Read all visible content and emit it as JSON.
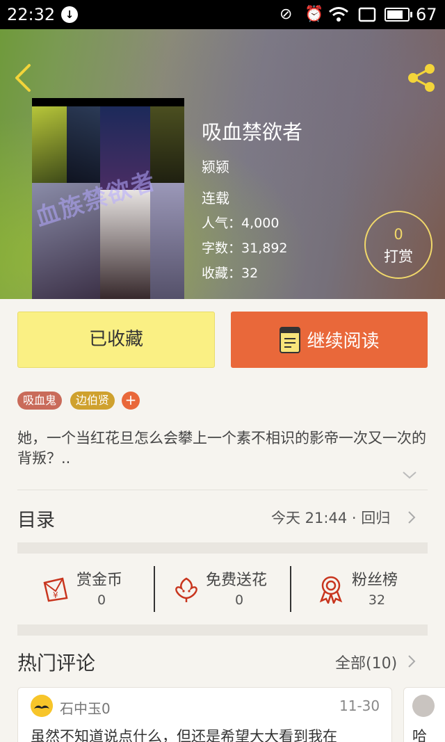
{
  "status_bar": {
    "time": "22:32",
    "battery": "67"
  },
  "book": {
    "title": "吸血禁欲者",
    "author": "颍颍",
    "status": "连载",
    "popularity_label": "人气：",
    "popularity": "4,000",
    "words_label": "字数：",
    "words": "31,892",
    "favorites_label": "收藏：",
    "favorites": "32",
    "cover_watermark": "血族禁欲者"
  },
  "tip": {
    "count": "0",
    "label": "打赏"
  },
  "buttons": {
    "favorite": "已收藏",
    "continue_reading": "继续阅读"
  },
  "tags": [
    "吸血鬼",
    "边伯贤"
  ],
  "tag_add": "+",
  "description": "她，一个当红花旦怎么会攀上一个素不相识的影帝一次又一次的背叛？..",
  "catalog": {
    "title": "目录",
    "update": "今天 21:44 · 回归"
  },
  "actions": [
    {
      "label": "赏金币",
      "value": "0",
      "icon": "red-envelope-icon"
    },
    {
      "label": "免费送花",
      "value": "0",
      "icon": "flower-icon"
    },
    {
      "label": "粉丝榜",
      "value": "32",
      "icon": "award-ribbon-icon"
    }
  ],
  "comments": {
    "title": "热门评论",
    "all": "全部(10)",
    "items": [
      {
        "user": "石中玉0",
        "date": "11-30",
        "text": "虽然不知道说点什么，但还是希望大大看到我在"
      },
      {
        "text": "哈"
      }
    ]
  },
  "colors": {
    "accent": "#e9683a",
    "favorite_bg": "#faf084",
    "tip_ring": "#f1d86a",
    "tag_vampire": "#c96b5a",
    "tag_name": "#cfa12e"
  }
}
